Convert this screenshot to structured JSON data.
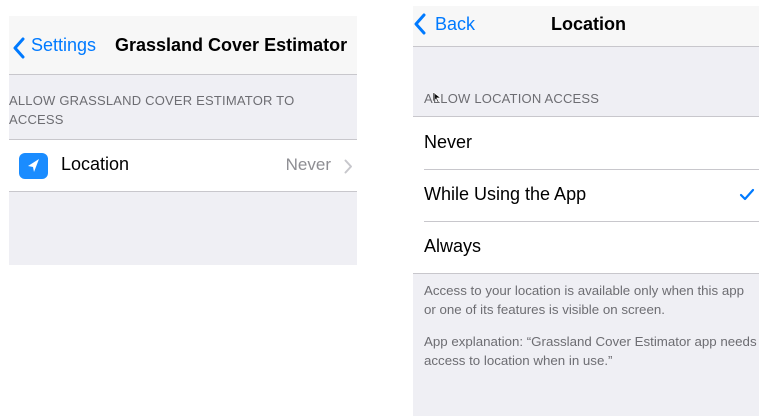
{
  "left_screen": {
    "nav": {
      "back_label": "Settings",
      "title": "Grassland Cover Estimator"
    },
    "section_header": "ALLOW GRASSLAND COVER ESTIMATOR TO ACCESS",
    "row": {
      "icon": "location-arrow-icon",
      "label": "Location",
      "value": "Never"
    }
  },
  "right_screen": {
    "nav": {
      "back_label": "Back",
      "title": "Location"
    },
    "section_header": "ALLOW LOCATION ACCESS",
    "options": [
      {
        "label": "Never",
        "selected": false
      },
      {
        "label": "While Using the App",
        "selected": true
      },
      {
        "label": "Always",
        "selected": false
      }
    ],
    "footer": [
      "Access to your location is available only when this app or one of its features is visible on screen.",
      "App explanation: “Grassland Cover Estimator app needs access to location when in use.”"
    ]
  },
  "colors": {
    "accent": "#007aff",
    "icon_bg": "#1a8cff",
    "group_bg": "#efeff4",
    "secondary_text": "#6d6d72"
  }
}
